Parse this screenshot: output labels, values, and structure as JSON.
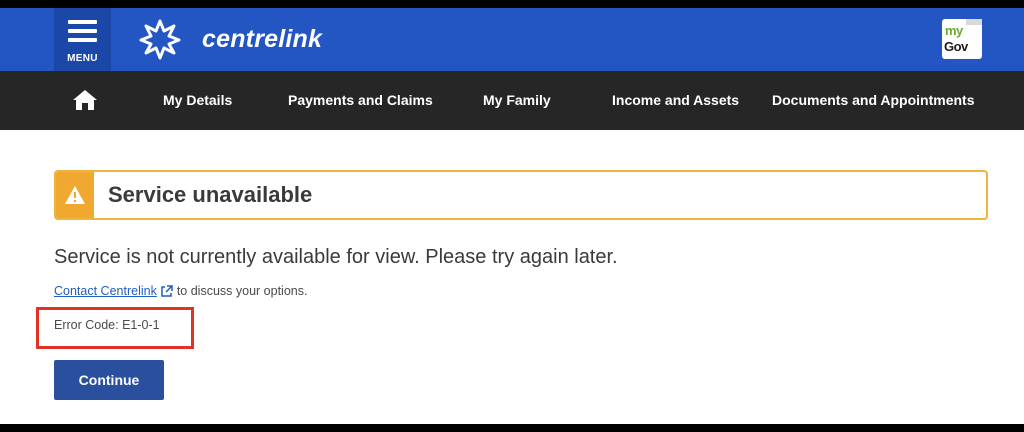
{
  "header": {
    "menu_label": "MENU",
    "brand_name": "centrelink",
    "mygov_my": "my",
    "mygov_gov": "Gov"
  },
  "nav": {
    "home_icon": "home-icon",
    "items": [
      {
        "label": "My Details"
      },
      {
        "label": "Payments and Claims"
      },
      {
        "label": "My Family"
      },
      {
        "label": "Income and Assets"
      },
      {
        "label": "Documents and Appointments"
      }
    ]
  },
  "alert": {
    "icon": "warning-icon",
    "title": "Service unavailable"
  },
  "main": {
    "message": "Service is not currently available for view. Please try again later.",
    "contact_link": "Contact Centrelink",
    "contact_suffix": "to discuss your options.",
    "error_code": "Error Code: E1-0-1",
    "continue_label": "Continue"
  },
  "colors": {
    "header_blue": "#2356c2",
    "nav_dark": "#262626",
    "alert_orange": "#f0a830",
    "highlight_red": "#e03326",
    "button_blue": "#2a4f9e"
  }
}
